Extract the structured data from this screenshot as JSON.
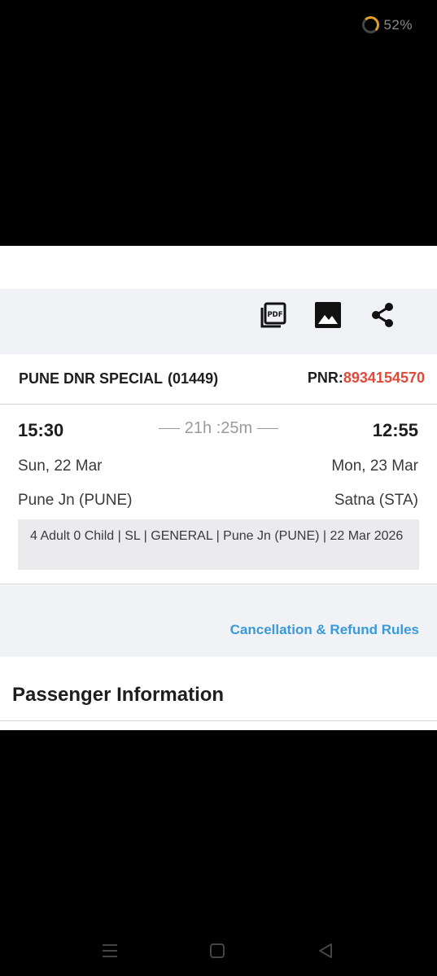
{
  "status_bar": {
    "battery_percent_label": "52%",
    "battery_level": 0.52,
    "battery_icon": "battery-ring-icon"
  },
  "toolbar": {
    "icons": [
      "pdf-icon",
      "image-icon",
      "share-icon"
    ]
  },
  "train": {
    "name": "PUNE DNR SPECIAL",
    "number": "(01449)",
    "pnr_label": "PNR:",
    "pnr_value": "8934154570"
  },
  "journey": {
    "departure_time": "15:30",
    "arrival_time": "12:55",
    "duration": "21h :25m",
    "departure_date": "Sun, 22 Mar",
    "arrival_date": "Mon, 23 Mar",
    "departure_station": "Pune Jn (PUNE)",
    "arrival_station": "Satna (STA)",
    "summary": "4 Adult 0 Child  | SL | GENERAL | Pune Jn (PUNE) | 22 Mar 2026"
  },
  "links": {
    "cancellation_rules": "Cancellation & Refund Rules"
  },
  "passenger": {
    "section_title": "Passenger Information"
  },
  "nav": {
    "icons": [
      "menu-icon",
      "home-icon",
      "back-icon"
    ]
  },
  "colors": {
    "accent_link": "#3a9ad9",
    "pnr_red": "#e04a3a",
    "toolbar_bg": "#f1f2f6"
  }
}
